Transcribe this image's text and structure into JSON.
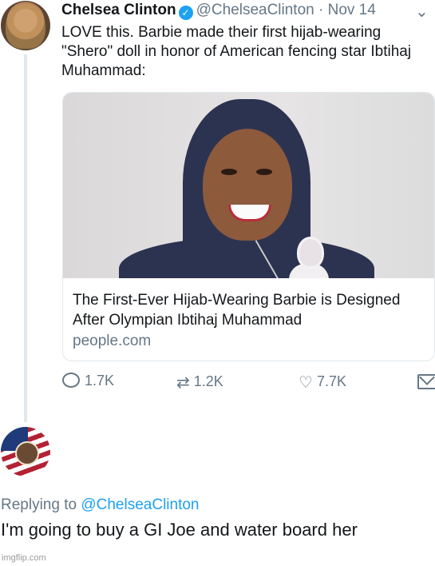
{
  "tweet": {
    "author_name": "Chelsea Clinton",
    "handle": "@ChelseaClinton",
    "separator": "·",
    "date": "Nov 14",
    "text": "LOVE this. Barbie made their first hijab-wearing \"Shero\" doll in honor of American fencing star Ibtihaj Muhammad:",
    "card": {
      "title": "The First-Ever Hijab-Wearing Barbie is Designed After Olympian Ibtihaj Muhammad",
      "domain": "people.com"
    },
    "actions": {
      "replies": "1.7K",
      "retweets": "1.2K",
      "likes": "7.7K"
    }
  },
  "reply": {
    "replying_label": "Replying to",
    "replying_to": "@ChelseaClinton",
    "text": "I'm going to buy a GI Joe and water board her"
  },
  "watermark": "imgflip.com",
  "icons": {
    "verified": "verified-badge-icon",
    "chevron": "chevron-down-icon",
    "reply": "reply-icon",
    "retweet": "retweet-icon",
    "like": "heart-icon",
    "message": "mail-icon"
  },
  "colors": {
    "accent": "#1da1f2",
    "muted": "#657786",
    "text": "#14171a",
    "border": "#e1e8ed"
  }
}
